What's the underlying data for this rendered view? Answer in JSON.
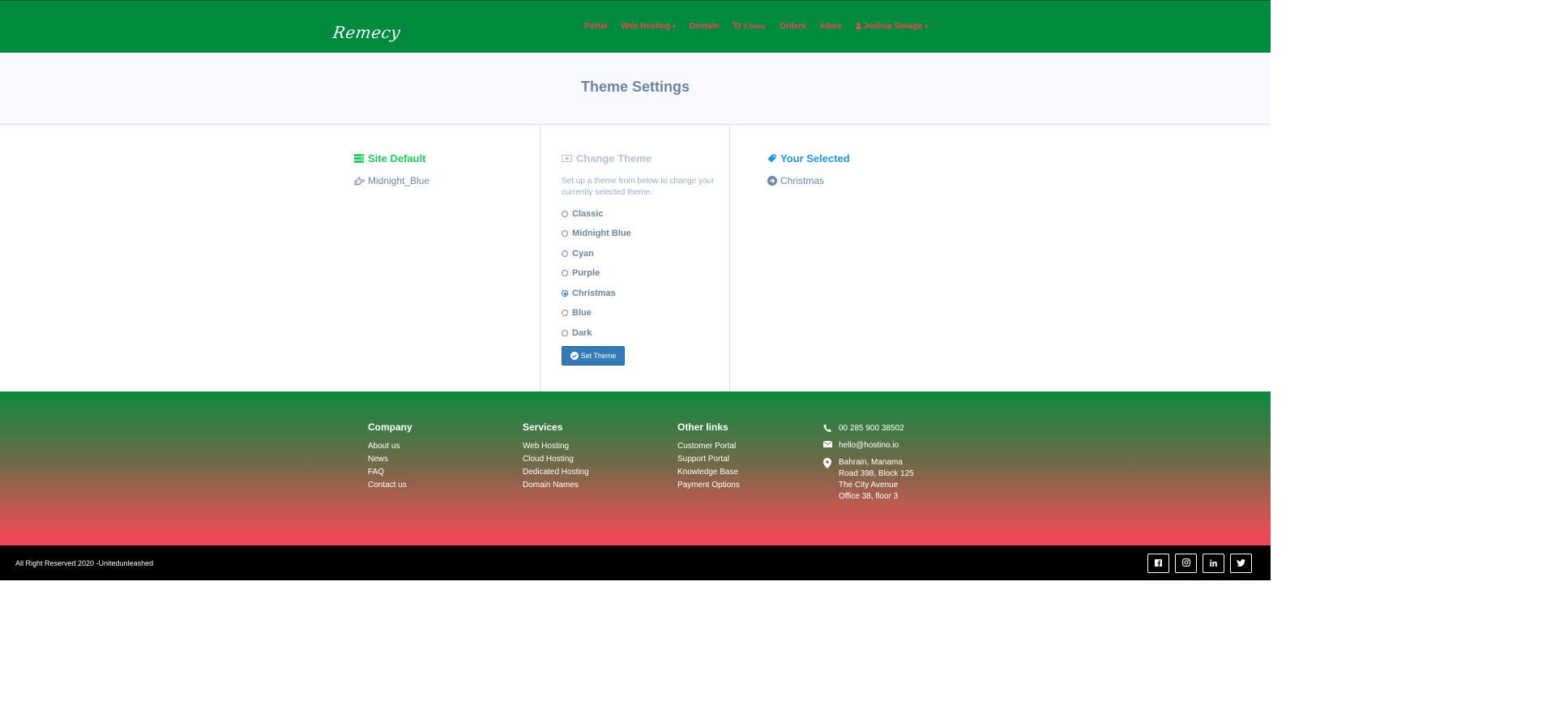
{
  "brand": {
    "logo_text": "Remecy"
  },
  "nav": {
    "portal": "Portal",
    "web_hosting": "Web Hosting",
    "domain": "Domain",
    "cart": "0 Items",
    "orders": "Orders",
    "inbox": "Inbox",
    "user": "Joshua Savage"
  },
  "page": {
    "title": "Theme Settings"
  },
  "site_default": {
    "title": "Site Default",
    "value": "Midnight_Blue"
  },
  "change_theme": {
    "title": "Change Theme",
    "description": "Set up a theme from below to change your currently selected theme.",
    "options": [
      "Classic",
      "Midnight Blue",
      "Cyan",
      "Purple",
      "Christmas",
      "Blue",
      "Dark"
    ],
    "selected": "Christmas",
    "button_label": "Set Theme"
  },
  "your_selected": {
    "title": "Your Selected",
    "value": "Christmas"
  },
  "footer": {
    "company": {
      "heading": "Company",
      "links": [
        "About us",
        "News",
        "FAQ",
        "Contact us"
      ]
    },
    "services": {
      "heading": "Services",
      "links": [
        "Web Hosting",
        "Cloud Hosting",
        "Dedicated Hosting",
        "Domain Names"
      ]
    },
    "other": {
      "heading": "Other links",
      "links": [
        "Customer Portal",
        "Support Portal",
        "Knowledge Base",
        "Payment Options"
      ]
    },
    "contact": {
      "phone": "00 285 900 38502",
      "email": "hello@hostino.io",
      "address": [
        "Bahrain, Manama",
        "Road 398, Block 125",
        "The City Avenue",
        "Office 38, floor 3"
      ]
    }
  },
  "bottom": {
    "copyright": "All Right Reserved 2020 -Unitedunleashed"
  },
  "colors": {
    "navbar_bg": "#008a3f",
    "nav_link": "#f0474a",
    "site_default_accent": "#1fcb5c",
    "selected_accent": "#1f95e6",
    "button_bg": "#337ab7",
    "footer_gradient_top": "#0e8a3f",
    "footer_gradient_bottom": "#f4455a"
  },
  "icons": {
    "site_default": "server-icon",
    "site_default_value": "hand-pointing-icon",
    "change_theme": "money-icon",
    "your_selected": "tag-icon",
    "selected_value": "arrow-circle-right-icon",
    "button": "check-circle-icon",
    "socials": [
      "facebook-icon",
      "instagram-icon",
      "linkedin-icon",
      "twitter-icon"
    ]
  }
}
